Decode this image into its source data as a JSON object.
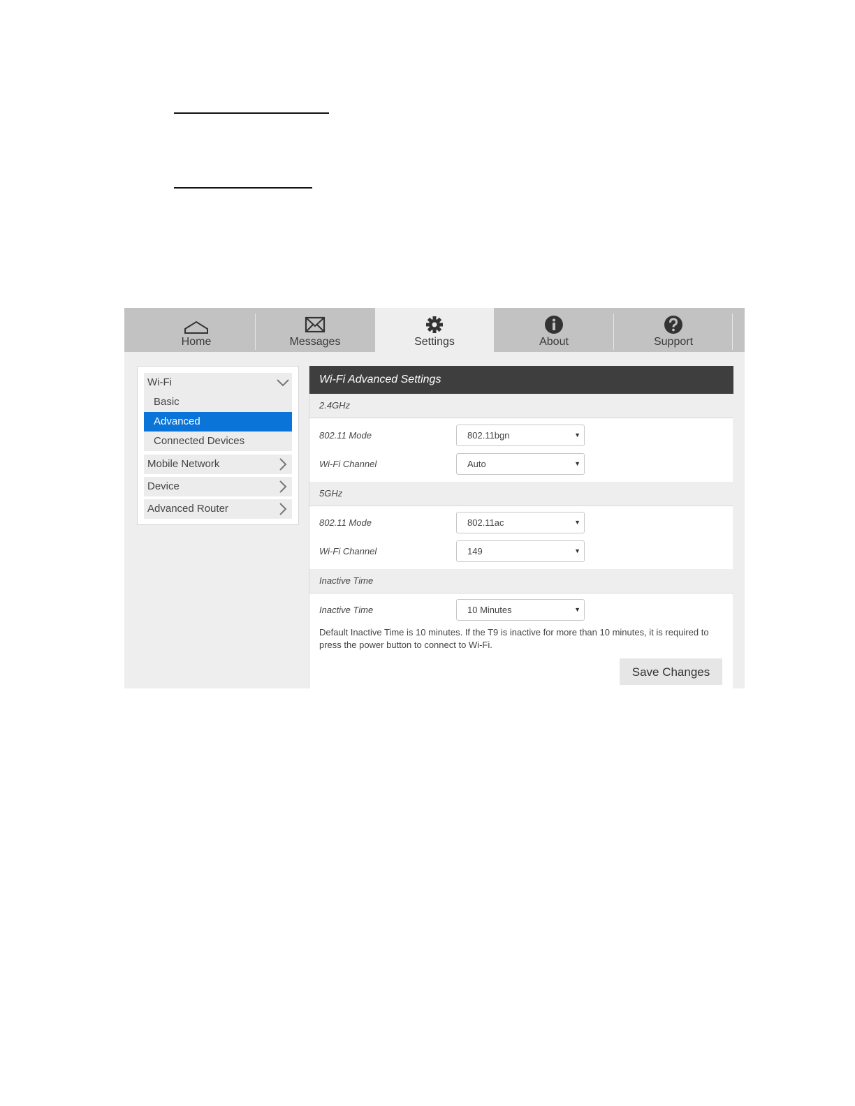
{
  "nav": {
    "tabs": [
      {
        "label": "Home",
        "icon": "home-icon"
      },
      {
        "label": "Messages",
        "icon": "envelope-icon"
      },
      {
        "label": "Settings",
        "icon": "gear-icon"
      },
      {
        "label": "About",
        "icon": "info-icon"
      },
      {
        "label": "Support",
        "icon": "question-icon"
      }
    ],
    "active_tab": "Settings"
  },
  "sidebar": {
    "groups": [
      {
        "label": "Wi-Fi",
        "expanded": true
      },
      {
        "label": "Mobile Network",
        "expanded": false
      },
      {
        "label": "Device",
        "expanded": false
      },
      {
        "label": "Advanced Router",
        "expanded": false
      }
    ],
    "wifi_items": [
      {
        "label": "Basic"
      },
      {
        "label": "Advanced",
        "selected": true
      },
      {
        "label": "Connected Devices"
      }
    ]
  },
  "panel": {
    "title": "Wi-Fi Advanced Settings",
    "sections": [
      {
        "heading": "2.4GHz",
        "rows": [
          {
            "label": "802.11 Mode",
            "value": "802.11bgn"
          },
          {
            "label": "Wi-Fi Channel",
            "value": "Auto"
          }
        ]
      },
      {
        "heading": "5GHz",
        "rows": [
          {
            "label": "802.11 Mode",
            "value": "802.11ac"
          },
          {
            "label": "Wi-Fi Channel",
            "value": "149"
          }
        ]
      },
      {
        "heading": "Inactive Time",
        "rows": [
          {
            "label": "Inactive Time",
            "value": "10 Minutes"
          }
        ]
      }
    ],
    "note": "Default Inactive Time is 10 minutes. If the T9 is inactive for more than 10 minutes, it is required to press the power button to connect to Wi-Fi.",
    "save_label": "Save Changes"
  },
  "colors": {
    "selected_blue": "#0a74d8",
    "header_dark": "#3e3e3e",
    "tabbar_gray": "#c2c2c2"
  }
}
